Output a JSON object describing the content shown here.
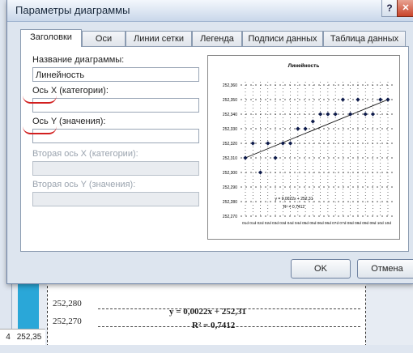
{
  "dialog": {
    "title": "Параметры диаграммы",
    "help_glyph": "?",
    "close_glyph": "✕",
    "tabs": [
      {
        "label": "Заголовки",
        "active": true
      },
      {
        "label": "Оси"
      },
      {
        "label": "Линии сетки"
      },
      {
        "label": "Легенда"
      },
      {
        "label": "Подписи данных"
      },
      {
        "label": "Таблица данных"
      }
    ],
    "fields": {
      "chart_title_label": "Название диаграммы:",
      "chart_title_value": "Линейность",
      "x_axis_label": "Ось X (категории):",
      "x_axis_value": "",
      "y_axis_label": "Ось Y (значения):",
      "y_axis_value": "",
      "x2_axis_label": "Вторая ось X (категории):",
      "y2_axis_label": "Вторая ось Y (значения):"
    },
    "ok_label": "OK",
    "cancel_label": "Отмена"
  },
  "background": {
    "cell_left": "4",
    "cell_right": "252,35",
    "chart_y_ticks": [
      "252,280",
      "252,270"
    ],
    "equation": "y = 0,0022x + 252,31",
    "r_squared": "R² = 0,7412"
  },
  "colors": {
    "dialog_bg": "#dde5ef",
    "marker": "#0d1a4a",
    "annotation": "#d21f1f",
    "cyan": "#2aa7d8"
  },
  "chart_data": {
    "type": "scatter",
    "title": "Линейность",
    "xlabel": "",
    "ylabel": "",
    "y_ticks": [
      "252,360",
      "252,350",
      "252,340",
      "252,330",
      "252,320",
      "252,310",
      "252,300",
      "252,290",
      "252,280",
      "252,270"
    ],
    "x_ticks": [
      "01d",
      "01d",
      "02d",
      "02d",
      "03d",
      "03d",
      "04d",
      "04d",
      "05d",
      "05d",
      "06d",
      "06d",
      "07d",
      "07d",
      "08d",
      "08d",
      "09d",
      "09d",
      "10d",
      "10d"
    ],
    "ylim": [
      252.27,
      252.36
    ],
    "points": [
      {
        "x": 1,
        "y": 252.31
      },
      {
        "x": 2,
        "y": 252.32
      },
      {
        "x": 3,
        "y": 252.3
      },
      {
        "x": 4,
        "y": 252.32
      },
      {
        "x": 5,
        "y": 252.31
      },
      {
        "x": 6,
        "y": 252.32
      },
      {
        "x": 7,
        "y": 252.32
      },
      {
        "x": 8,
        "y": 252.33
      },
      {
        "x": 9,
        "y": 252.33
      },
      {
        "x": 10,
        "y": 252.335
      },
      {
        "x": 11,
        "y": 252.34
      },
      {
        "x": 12,
        "y": 252.34
      },
      {
        "x": 13,
        "y": 252.34
      },
      {
        "x": 14,
        "y": 252.35
      },
      {
        "x": 15,
        "y": 252.34
      },
      {
        "x": 16,
        "y": 252.35
      },
      {
        "x": 17,
        "y": 252.34
      },
      {
        "x": 18,
        "y": 252.34
      },
      {
        "x": 19,
        "y": 252.35
      },
      {
        "x": 20,
        "y": 252.35
      }
    ],
    "trendline": {
      "x": [
        1,
        20
      ],
      "y": [
        252.31,
        252.35
      ]
    },
    "equation": "y = 0,0022x + 252,31",
    "r_squared": "R² = 0,7412",
    "grid": true,
    "legend": "none"
  }
}
